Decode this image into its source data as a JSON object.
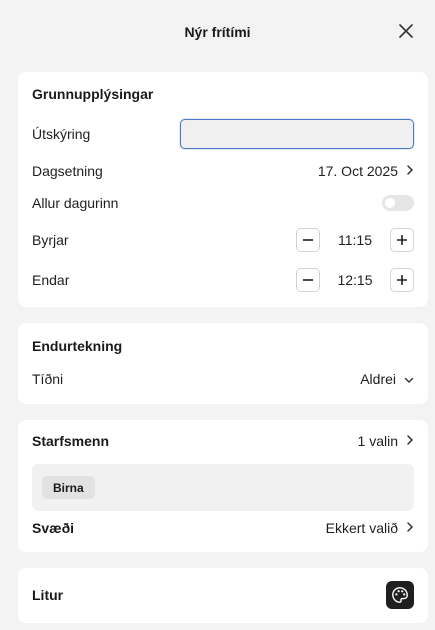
{
  "header": {
    "title": "Nýr frítími",
    "close_icon": "close-icon"
  },
  "basic": {
    "title": "Grunnupplýsingar",
    "description_label": "Útskýring",
    "description_value": "",
    "date_label": "Dagsetning",
    "date_value": "17. Oct 2025",
    "allday_label": "Allur dagurinn",
    "allday_on": false,
    "start_label": "Byrjar",
    "start_value": "11:15",
    "end_label": "Endar",
    "end_value": "12:15"
  },
  "recurrence": {
    "title": "Endurtekning",
    "frequency_label": "Tíðni",
    "frequency_value": "Aldrei"
  },
  "staff": {
    "title": "Starfsmenn",
    "selected_text": "1 valin",
    "chips": [
      "Birna"
    ],
    "area_label": "Svæði",
    "area_value": "Ekkert valið"
  },
  "color": {
    "title": "Litur",
    "icon": "palette-icon"
  },
  "colors": {
    "accent": "#4a78c9",
    "background": "#f3f3f3",
    "card": "#ffffff",
    "palette_button": "#1f1f1f"
  }
}
